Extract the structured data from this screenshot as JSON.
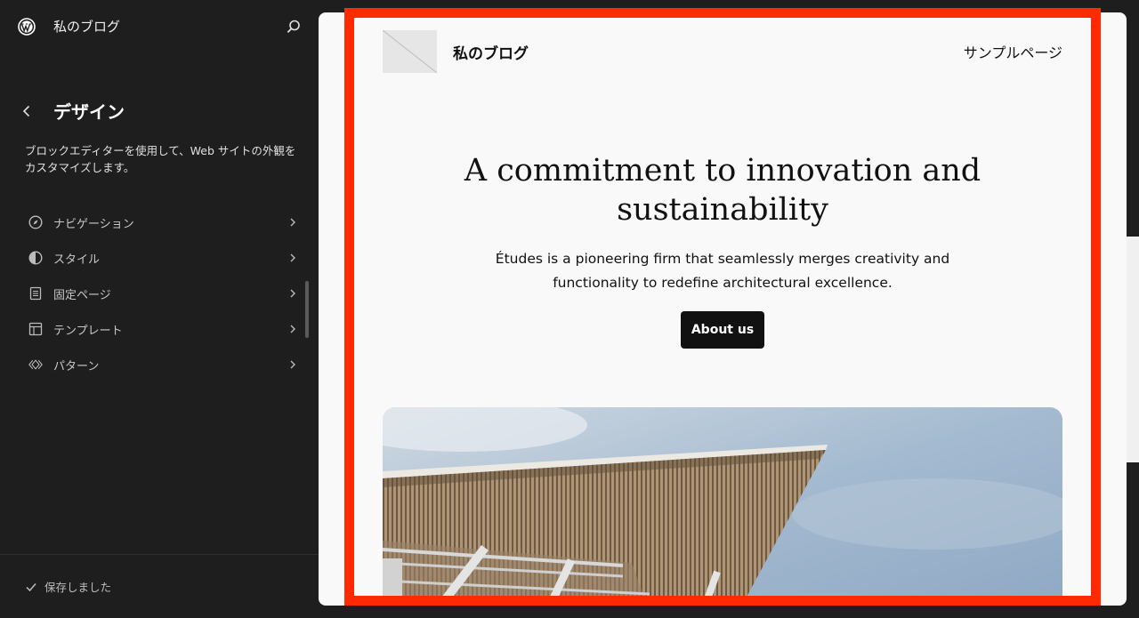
{
  "header": {
    "site_title": "私のブログ",
    "logo_icon": "wordpress-icon",
    "search_icon": "search-icon"
  },
  "panel": {
    "back_icon": "chevron-left-icon",
    "title": "デザイン",
    "description": "ブロックエディターを使用して、Web サイトの外観をカスタマイズします。"
  },
  "nav": {
    "items": [
      {
        "label": "ナビゲーション",
        "icon": "navigation-icon"
      },
      {
        "label": "スタイル",
        "icon": "styles-icon"
      },
      {
        "label": "固定ページ",
        "icon": "page-icon"
      },
      {
        "label": "テンプレート",
        "icon": "template-icon"
      },
      {
        "label": "パターン",
        "icon": "pattern-icon"
      }
    ]
  },
  "footer": {
    "saved_label": "保存しました",
    "saved_icon": "check-icon"
  },
  "preview": {
    "site_name": "私のブログ",
    "nav_link": "サンプルページ",
    "hero_title": "A commitment to innovation and sustainability",
    "hero_text": "Études is a pioneering firm that seamlessly merges creativity and functionality to redefine architectural excellence.",
    "button_label": "About us"
  },
  "colors": {
    "sidebar_bg": "#1e1e1e",
    "canvas_bg": "#f9f9f9",
    "button_bg": "#111111",
    "highlight": "#ff2a00"
  }
}
